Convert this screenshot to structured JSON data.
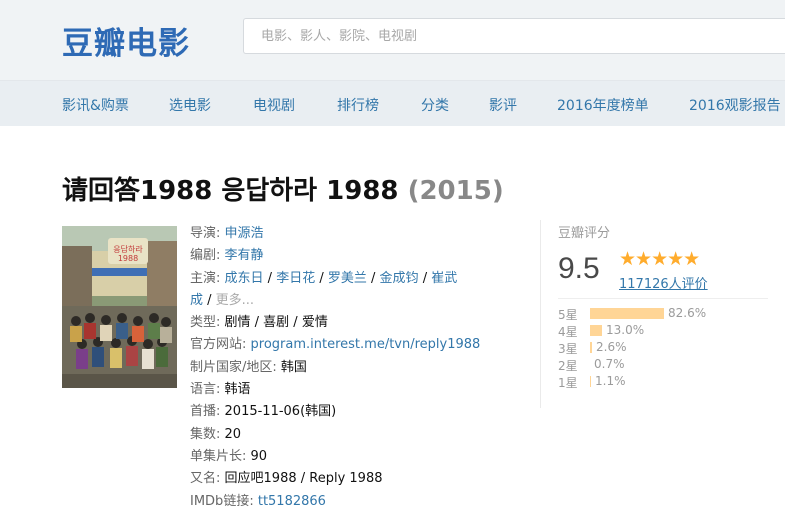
{
  "header": {
    "logo": "豆瓣电影",
    "search_placeholder": "电影、影人、影院、电视剧"
  },
  "nav": [
    "影讯&购票",
    "选电影",
    "电视剧",
    "排行榜",
    "分类",
    "影评",
    "2016年度榜单",
    "2016观影报告"
  ],
  "title": {
    "name": "请回答1988 응답하라 1988",
    "year": "(2015)"
  },
  "info": {
    "director_label": "导演",
    "director": "申源浩",
    "writer_label": "编剧",
    "writer": "李有静",
    "cast_label": "主演",
    "cast": [
      "成东日",
      "李日花",
      "罗美兰",
      "金成钧",
      "崔武成"
    ],
    "more": "更多...",
    "genre_label": "类型",
    "genre": "剧情 / 喜剧 / 爱情",
    "site_label": "官方网站",
    "site": "program.interest.me/tvn/reply1988",
    "country_label": "制片国家/地区",
    "country": "韩国",
    "lang_label": "语言",
    "lang": "韩语",
    "premiere_label": "首播",
    "premiere": "2015-11-06(韩国)",
    "episodes_label": "集数",
    "episodes": "20",
    "runtime_label": "单集片长",
    "runtime": "90",
    "aka_label": "又名",
    "aka": "回应吧1988 / Reply 1988",
    "imdb_label": "IMDb链接",
    "imdb": "tt5182866"
  },
  "rating": {
    "label": "豆瓣评分",
    "score": "9.5",
    "stars": "★★★★★",
    "votes": "117126人评价",
    "colors": {
      "bar": "#ffd596",
      "star": "#ffac2d"
    },
    "breakdown": [
      {
        "star": "5星",
        "pct": "82.6%",
        "value": 82.6
      },
      {
        "star": "4星",
        "pct": "13.0%",
        "value": 13.0
      },
      {
        "star": "3星",
        "pct": "2.6%",
        "value": 2.6
      },
      {
        "star": "2星",
        "pct": "0.7%",
        "value": 0.7
      },
      {
        "star": "1星",
        "pct": "1.1%",
        "value": 1.1
      }
    ]
  }
}
